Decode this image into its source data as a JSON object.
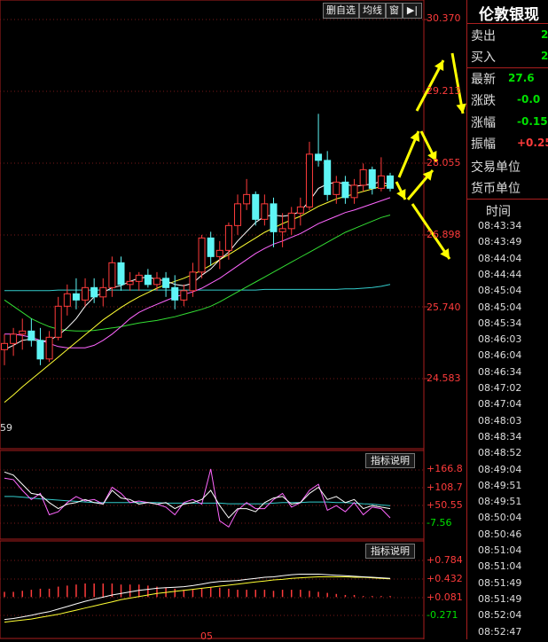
{
  "toolbar": {
    "delete_watch": "删自选",
    "ma_lines": "均线",
    "window": "窗",
    "arrow": "▶|"
  },
  "price_axis": [
    "30.370",
    "29.213",
    "28.055",
    "26.898",
    "25.740",
    "24.583"
  ],
  "partial_label": "59",
  "indicator1": {
    "title": "指标说明",
    "ticks": [
      "+166.8",
      "+108.7",
      "+50.55",
      "-7.56"
    ]
  },
  "indicator2": {
    "title": "指标说明",
    "ticks": [
      "+0.784",
      "+0.432",
      "+0.081",
      "-0.271"
    ]
  },
  "bottom_partial": "05",
  "quote": {
    "name": "伦敦银现",
    "rows": [
      {
        "label": "卖出",
        "value": "2",
        "color": "#00e000"
      },
      {
        "label": "买入",
        "value": "2",
        "color": "#00e000"
      },
      {
        "label": "最新",
        "value": "27.6",
        "color": "#00e000"
      },
      {
        "label": "涨跌",
        "value": "-0.0",
        "color": "#00e000"
      },
      {
        "label": "涨幅",
        "value": "-0.15",
        "color": "#00e000"
      },
      {
        "label": "振幅",
        "value": "+0.25",
        "color": "#ff3b3b"
      }
    ],
    "trade_unit": "交易单位",
    "currency_unit": "货币单位",
    "time_header": "时间",
    "times": [
      "08:43:34",
      "08:43:49",
      "08:44:04",
      "08:44:44",
      "08:45:04",
      "08:45:04",
      "08:45:34",
      "08:46:03",
      "08:46:04",
      "08:46:34",
      "08:47:02",
      "08:47:04",
      "08:48:03",
      "08:48:34",
      "08:48:52",
      "08:49:04",
      "08:49:51",
      "08:49:51",
      "08:50:04",
      "08:50:46",
      "08:51:04",
      "08:51:04",
      "08:51:49",
      "08:51:49",
      "08:52:04",
      "08:52:47"
    ]
  },
  "colors": {
    "up": "#ff3b3b",
    "down": "#5ef5f5",
    "ma5": "#ffffff",
    "ma10": "#ffff33",
    "ma20": "#ff66ff",
    "ma60": "#33dd33",
    "ma_long": "#33cccc",
    "annotation": "#ffff00"
  },
  "chart_data": {
    "type": "candlestick",
    "title": "",
    "ylim": [
      24.0,
      30.37
    ],
    "candles": [
      {
        "o": 25.05,
        "h": 25.3,
        "l": 24.8,
        "c": 25.15
      },
      {
        "o": 25.15,
        "h": 25.4,
        "l": 24.95,
        "c": 25.3
      },
      {
        "o": 25.3,
        "h": 25.55,
        "l": 25.05,
        "c": 25.35
      },
      {
        "o": 25.35,
        "h": 25.55,
        "l": 25.1,
        "c": 25.2
      },
      {
        "o": 25.2,
        "h": 25.4,
        "l": 24.8,
        "c": 24.9
      },
      {
        "o": 24.9,
        "h": 25.35,
        "l": 24.85,
        "c": 25.25
      },
      {
        "o": 25.25,
        "h": 25.9,
        "l": 25.2,
        "c": 25.75
      },
      {
        "o": 25.75,
        "h": 26.1,
        "l": 25.6,
        "c": 25.95
      },
      {
        "o": 25.95,
        "h": 26.2,
        "l": 25.7,
        "c": 25.85
      },
      {
        "o": 25.85,
        "h": 26.2,
        "l": 25.75,
        "c": 26.05
      },
      {
        "o": 26.05,
        "h": 26.2,
        "l": 25.8,
        "c": 25.9
      },
      {
        "o": 25.9,
        "h": 26.2,
        "l": 25.75,
        "c": 26.05
      },
      {
        "o": 26.05,
        "h": 26.55,
        "l": 25.9,
        "c": 26.45
      },
      {
        "o": 26.45,
        "h": 26.55,
        "l": 26.0,
        "c": 26.1
      },
      {
        "o": 26.1,
        "h": 26.3,
        "l": 26.0,
        "c": 26.15
      },
      {
        "o": 26.15,
        "h": 26.3,
        "l": 26.0,
        "c": 26.25
      },
      {
        "o": 26.25,
        "h": 26.35,
        "l": 26.05,
        "c": 26.1
      },
      {
        "o": 26.1,
        "h": 26.3,
        "l": 26.0,
        "c": 26.2
      },
      {
        "o": 26.2,
        "h": 26.3,
        "l": 25.9,
        "c": 26.05
      },
      {
        "o": 26.05,
        "h": 26.25,
        "l": 25.7,
        "c": 25.85
      },
      {
        "o": 25.85,
        "h": 26.1,
        "l": 25.75,
        "c": 26.0
      },
      {
        "o": 26.0,
        "h": 26.45,
        "l": 25.9,
        "c": 26.3
      },
      {
        "o": 26.3,
        "h": 26.9,
        "l": 26.2,
        "c": 26.85
      },
      {
        "o": 26.85,
        "h": 26.95,
        "l": 26.4,
        "c": 26.55
      },
      {
        "o": 26.55,
        "h": 26.8,
        "l": 26.35,
        "c": 26.65
      },
      {
        "o": 26.65,
        "h": 27.1,
        "l": 26.5,
        "c": 27.05
      },
      {
        "o": 27.05,
        "h": 27.55,
        "l": 26.9,
        "c": 27.4
      },
      {
        "o": 27.4,
        "h": 27.8,
        "l": 27.3,
        "c": 27.55
      },
      {
        "o": 27.55,
        "h": 27.6,
        "l": 27.05,
        "c": 27.15
      },
      {
        "o": 27.15,
        "h": 27.55,
        "l": 27.05,
        "c": 27.4
      },
      {
        "o": 27.4,
        "h": 27.5,
        "l": 26.7,
        "c": 26.95
      },
      {
        "o": 26.95,
        "h": 27.25,
        "l": 26.7,
        "c": 27.0
      },
      {
        "o": 27.0,
        "h": 27.35,
        "l": 26.9,
        "c": 27.25
      },
      {
        "o": 27.25,
        "h": 27.5,
        "l": 27.05,
        "c": 27.35
      },
      {
        "o": 27.35,
        "h": 28.4,
        "l": 27.3,
        "c": 28.2
      },
      {
        "o": 28.2,
        "h": 28.85,
        "l": 28.0,
        "c": 28.1
      },
      {
        "o": 28.1,
        "h": 28.25,
        "l": 27.45,
        "c": 27.55
      },
      {
        "o": 27.55,
        "h": 27.85,
        "l": 27.4,
        "c": 27.75
      },
      {
        "o": 27.75,
        "h": 27.85,
        "l": 27.4,
        "c": 27.5
      },
      {
        "o": 27.5,
        "h": 27.8,
        "l": 27.4,
        "c": 27.7
      },
      {
        "o": 27.7,
        "h": 28.05,
        "l": 27.6,
        "c": 27.95
      },
      {
        "o": 27.95,
        "h": 28.0,
        "l": 27.55,
        "c": 27.65
      },
      {
        "o": 27.65,
        "h": 28.15,
        "l": 27.6,
        "c": 27.85
      },
      {
        "o": 27.85,
        "h": 27.9,
        "l": 27.6,
        "c": 27.65
      }
    ],
    "ma5": [
      25.05,
      25.12,
      25.2,
      25.22,
      25.18,
      25.2,
      25.28,
      25.4,
      25.55,
      25.75,
      25.9,
      25.97,
      26.05,
      26.08,
      26.15,
      26.2,
      26.22,
      26.18,
      26.16,
      26.1,
      26.08,
      26.12,
      26.25,
      26.35,
      26.5,
      26.62,
      26.8,
      26.95,
      27.1,
      27.2,
      27.22,
      27.2,
      27.22,
      27.28,
      27.45,
      27.65,
      27.72,
      27.75,
      27.72,
      27.68,
      27.7,
      27.72,
      27.76,
      27.7
    ],
    "ma10": [
      24.2,
      24.32,
      24.45,
      24.57,
      24.69,
      24.81,
      24.93,
      25.05,
      25.17,
      25.29,
      25.41,
      25.53,
      25.63,
      25.73,
      25.82,
      25.9,
      25.97,
      26.04,
      26.1,
      26.15,
      26.2,
      26.26,
      26.33,
      26.41,
      26.5,
      26.58,
      26.67,
      26.76,
      26.85,
      26.94,
      27.01,
      27.08,
      27.14,
      27.2,
      27.28,
      27.36,
      27.42,
      27.48,
      27.52,
      27.56,
      27.6,
      27.64,
      27.68,
      27.7
    ],
    "ma20": [
      25.3,
      25.3,
      25.28,
      25.25,
      25.2,
      25.15,
      25.1,
      25.08,
      25.08,
      25.08,
      25.12,
      25.2,
      25.3,
      25.42,
      25.55,
      25.65,
      25.72,
      25.78,
      25.84,
      25.9,
      25.94,
      25.98,
      26.04,
      26.12,
      26.2,
      26.3,
      26.4,
      26.5,
      26.6,
      26.68,
      26.75,
      26.8,
      26.86,
      26.92,
      27.0,
      27.08,
      27.14,
      27.2,
      27.26,
      27.3,
      27.35,
      27.4,
      27.45,
      27.5
    ],
    "ma60": [
      25.85,
      25.75,
      25.65,
      25.55,
      25.48,
      25.42,
      25.38,
      25.36,
      25.35,
      25.35,
      25.36,
      25.38,
      25.4,
      25.42,
      25.45,
      25.48,
      25.5,
      25.52,
      25.55,
      25.58,
      25.62,
      25.66,
      25.7,
      25.75,
      25.82,
      25.9,
      25.98,
      26.06,
      26.14,
      26.22,
      26.3,
      26.38,
      26.46,
      26.54,
      26.62,
      26.7,
      26.78,
      26.86,
      26.94,
      27.0,
      27.06,
      27.12,
      27.18,
      27.22
    ],
    "ma_long": [
      26.0,
      26.0,
      26.0,
      26.0,
      26.0,
      26.0,
      26.01,
      26.01,
      26.01,
      26.01,
      26.01,
      26.01,
      26.01,
      26.01,
      26.01,
      26.01,
      26.01,
      26.01,
      26.01,
      26.01,
      26.01,
      26.01,
      26.01,
      26.01,
      26.01,
      26.01,
      26.01,
      26.01,
      26.01,
      26.02,
      26.02,
      26.02,
      26.02,
      26.02,
      26.02,
      26.02,
      26.02,
      26.02,
      26.03,
      26.03,
      26.04,
      26.05,
      26.07,
      26.1
    ],
    "indicator1": {
      "ylim": [
        -40,
        190
      ],
      "white": [
        160,
        150,
        120,
        90,
        85,
        60,
        40,
        55,
        60,
        70,
        60,
        55,
        100,
        75,
        70,
        55,
        60,
        55,
        60,
        40,
        55,
        60,
        70,
        100,
        50,
        10,
        40,
        40,
        30,
        60,
        75,
        80,
        55,
        60,
        90,
        110,
        70,
        80,
        60,
        70,
        40,
        50,
        45,
        40
      ],
      "pink": [
        140,
        135,
        100,
        70,
        90,
        20,
        30,
        60,
        80,
        65,
        70,
        55,
        110,
        90,
        60,
        65,
        60,
        55,
        45,
        20,
        60,
        70,
        55,
        170,
        0,
        -20,
        35,
        60,
        40,
        40,
        70,
        90,
        45,
        60,
        100,
        120,
        35,
        50,
        30,
        60,
        20,
        45,
        40,
        10
      ],
      "yellow": [
        80,
        80,
        78,
        75,
        72,
        70,
        68,
        66,
        64,
        62,
        60,
        60,
        60,
        60,
        60,
        60,
        60,
        60,
        58,
        58,
        58,
        58,
        58,
        58,
        58,
        56,
        56,
        56,
        56,
        56,
        58,
        60,
        60,
        60,
        62,
        62,
        62,
        60,
        60,
        58,
        56,
        55,
        52,
        50
      ]
    },
    "indicator2": {
      "ylim": [
        -0.32,
        0.84
      ],
      "white": [
        -0.35,
        -0.33,
        -0.3,
        -0.27,
        -0.23,
        -0.2,
        -0.15,
        -0.1,
        -0.05,
        0.0,
        0.04,
        0.08,
        0.12,
        0.15,
        0.18,
        0.21,
        0.23,
        0.25,
        0.26,
        0.27,
        0.28,
        0.3,
        0.33,
        0.36,
        0.38,
        0.39,
        0.4,
        0.42,
        0.44,
        0.46,
        0.47,
        0.49,
        0.51,
        0.52,
        0.52,
        0.52,
        0.51,
        0.5,
        0.49,
        0.48,
        0.47,
        0.46,
        0.45,
        0.44
      ],
      "yellow": [
        -0.4,
        -0.38,
        -0.36,
        -0.34,
        -0.31,
        -0.28,
        -0.25,
        -0.21,
        -0.17,
        -0.13,
        -0.09,
        -0.05,
        -0.01,
        0.03,
        0.06,
        0.09,
        0.12,
        0.15,
        0.17,
        0.19,
        0.21,
        0.23,
        0.25,
        0.27,
        0.29,
        0.31,
        0.33,
        0.35,
        0.37,
        0.39,
        0.41,
        0.42,
        0.44,
        0.45,
        0.46,
        0.47,
        0.47,
        0.47,
        0.47,
        0.46,
        0.46,
        0.45,
        0.44,
        0.43
      ],
      "bars": [
        0.1,
        0.1,
        0.12,
        0.14,
        0.16,
        0.16,
        0.2,
        0.22,
        0.24,
        0.26,
        0.26,
        0.26,
        0.26,
        0.24,
        0.24,
        0.24,
        0.22,
        0.2,
        0.18,
        0.16,
        0.14,
        0.14,
        0.16,
        0.18,
        0.18,
        0.16,
        0.14,
        0.14,
        0.14,
        0.14,
        0.12,
        0.14,
        0.14,
        0.14,
        0.12,
        0.1,
        0.08,
        0.06,
        0.04,
        0.04,
        0.02,
        0.02,
        0.02,
        0.02
      ]
    }
  }
}
